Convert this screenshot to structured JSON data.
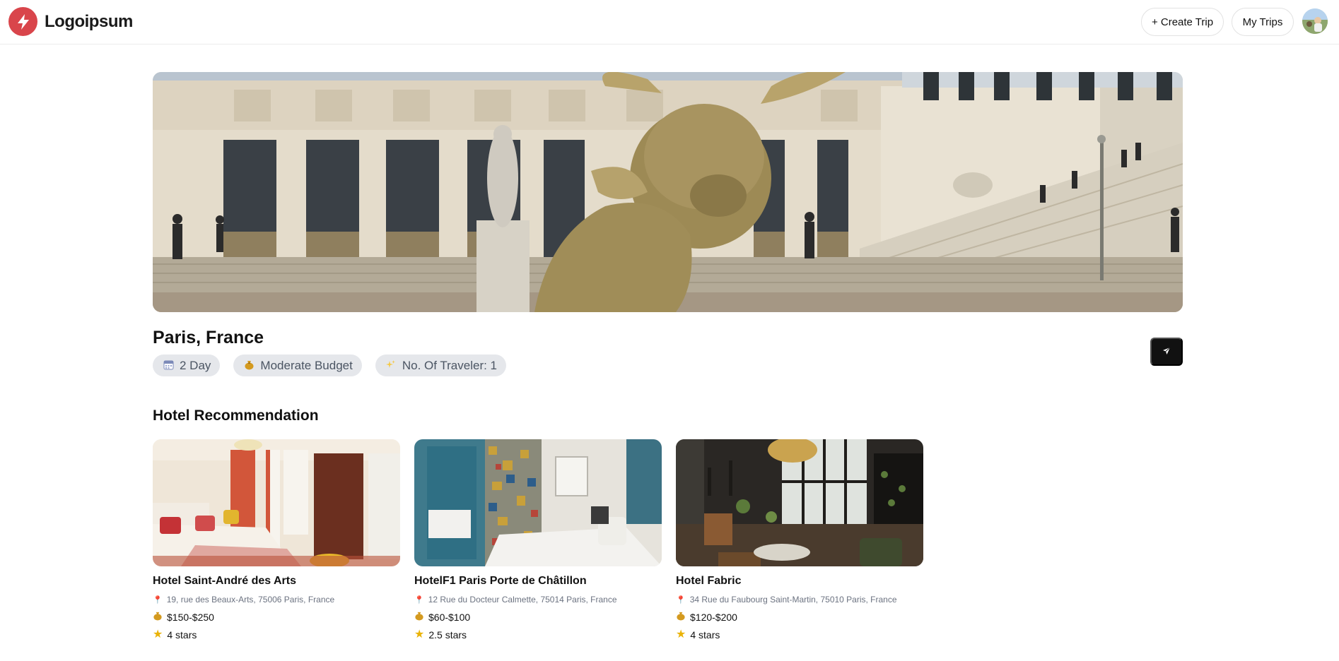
{
  "header": {
    "logo_text": "Logoipsum",
    "create_trip_label": "+ Create Trip",
    "my_trips_label": "My Trips"
  },
  "trip": {
    "destination": "Paris, France",
    "days_chip": "2 Day",
    "budget_chip": "Moderate Budget",
    "travelers_chip": "No. Of Traveler: 1"
  },
  "hotels": {
    "section_title": "Hotel Recommendation",
    "items": [
      {
        "name": "Hotel Saint-André des Arts",
        "address": "19, rue des Beaux-Arts, 75006 Paris, France",
        "price": "$150-$250",
        "rating": "4 stars"
      },
      {
        "name": "HotelF1 Paris Porte de Châtillon",
        "address": "12 Rue du Docteur Calmette, 75014 Paris, France",
        "price": "$60-$100",
        "rating": "2.5 stars"
      },
      {
        "name": "Hotel Fabric",
        "address": "34 Rue du Faubourg Saint-Martin, 75010 Paris, France",
        "price": "$120-$200",
        "rating": "4 stars"
      }
    ]
  },
  "icons": {
    "logo": "lightning-bolt-icon",
    "calendar": "calendar-icon",
    "budget": "money-bag-icon",
    "travelers": "sparkle-icon",
    "send": "send-icon",
    "location": "location-pin-icon",
    "price": "money-bag-icon",
    "rating": "star-icon"
  },
  "colors": {
    "brand": "#d9454b",
    "chip_bg": "#e5e7eb",
    "button_dark": "#111111"
  }
}
